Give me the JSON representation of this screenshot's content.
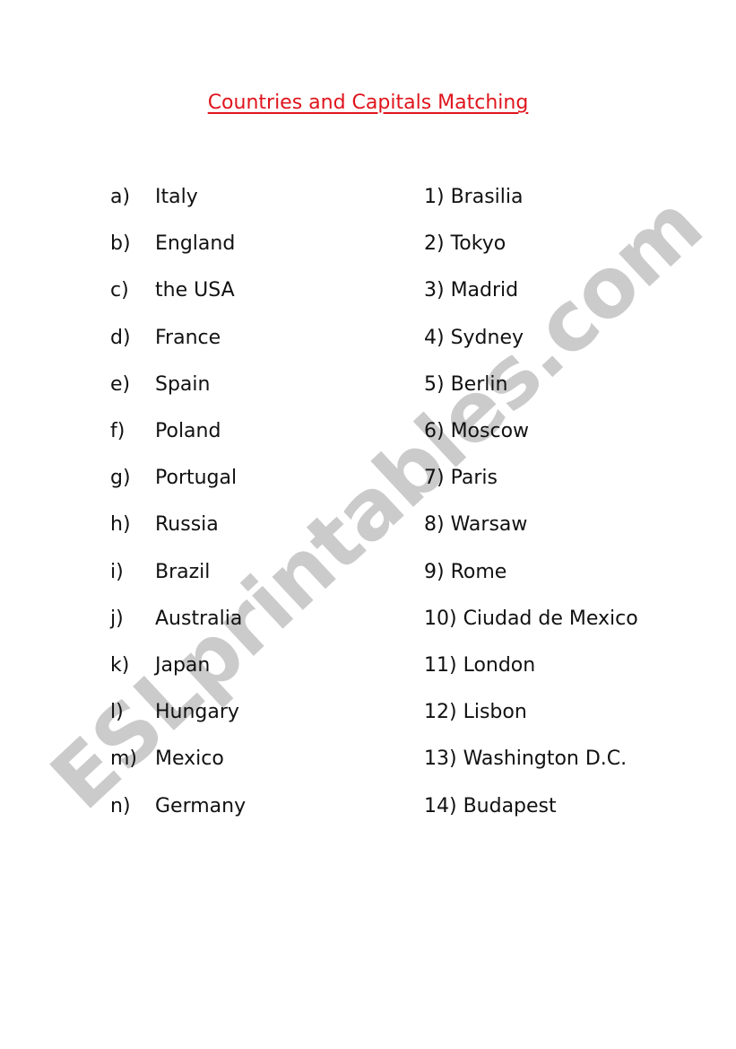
{
  "title": "Countries and Capitals Matching",
  "watermark": "ESLprintables.com",
  "countries": [
    {
      "letter": "a)",
      "name": "Italy"
    },
    {
      "letter": "b)",
      "name": "England"
    },
    {
      "letter": "c)",
      "name": "the USA"
    },
    {
      "letter": "d)",
      "name": "France"
    },
    {
      "letter": "e)",
      "name": "Spain"
    },
    {
      "letter": "f)",
      "name": "Poland"
    },
    {
      "letter": "g)",
      "name": "Portugal"
    },
    {
      "letter": "h)",
      "name": "Russia"
    },
    {
      "letter": "i)",
      "name": "Brazil"
    },
    {
      "letter": "j)",
      "name": "Australia"
    },
    {
      "letter": "k)",
      "name": "Japan"
    },
    {
      "letter": "l)",
      "name": "Hungary"
    },
    {
      "letter": "m)",
      "name": "Mexico"
    },
    {
      "letter": "n)",
      "name": "Germany"
    }
  ],
  "capitals": [
    "1) Brasilia",
    "2) Tokyo",
    "3) Madrid",
    "4) Sydney",
    "5) Berlin",
    "6) Moscow",
    "7) Paris",
    "8) Warsaw",
    "9) Rome",
    "10) Ciudad de Mexico",
    "11) London",
    "12) Lisbon",
    "13) Washington D.C.",
    "14) Budapest"
  ],
  "colors": {
    "title": "#e0141c",
    "watermark": "#cbcbcb",
    "text": "#111111"
  }
}
